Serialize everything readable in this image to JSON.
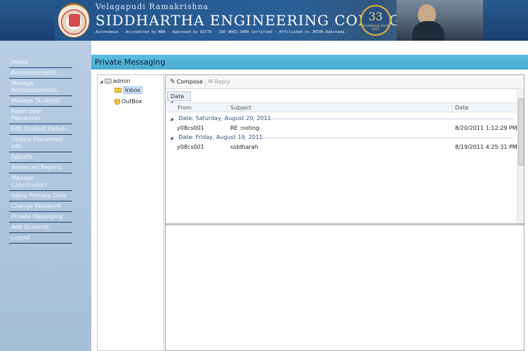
{
  "header": {
    "subtitle": "Velagapudi Ramakrishna",
    "title": "SIDDHARTHA ENGINEERING COLLEGE",
    "tagline": "Autonomous - Accredited by NBA - Approved by AICTE - ISO 9001:2000 Certified - Affiliated to JNTUK,Kakinada.",
    "anniversary_number": "33",
    "anniversary_text": "Excellence since 1977"
  },
  "sidebar": {
    "items": [
      {
        "label": "Home"
      },
      {
        "label": "Announcements"
      },
      {
        "label": "Manage Announcements"
      },
      {
        "label": "Manage Students"
      },
      {
        "label": "Reset User Passwords"
      },
      {
        "label": "Edit Student Details"
      },
      {
        "label": "Update Placement Info"
      },
      {
        "label": "Reports"
      },
      {
        "label": "Advanced Reports"
      },
      {
        "label": "Manage Coordinators"
      },
      {
        "label": "Setup Primary Data"
      },
      {
        "label": "Change Password"
      },
      {
        "label": "Private Messaging"
      },
      {
        "label": "Add Students"
      },
      {
        "label": "Logout"
      }
    ]
  },
  "main": {
    "title": "Private Messaging",
    "tree": {
      "root": "admin",
      "inbox": "Inbox",
      "outbox": "OutBox"
    },
    "toolbar": {
      "compose": "Compose",
      "reply": "Reply"
    },
    "grid": {
      "group_by": "Date",
      "columns": [
        "From",
        "Subject",
        "Date"
      ],
      "groups": [
        {
          "header": "Date: Saturday, August 20, 2011",
          "from": "y08cs001",
          "subject": "RE :noting",
          "date": "8/20/2011 1:12:29 PM"
        },
        {
          "header": "Date: Friday, August 19, 2011",
          "from": "y08cs001",
          "subject": "siddharah",
          "date": "8/19/2011 4:25:31 PM"
        }
      ]
    }
  }
}
